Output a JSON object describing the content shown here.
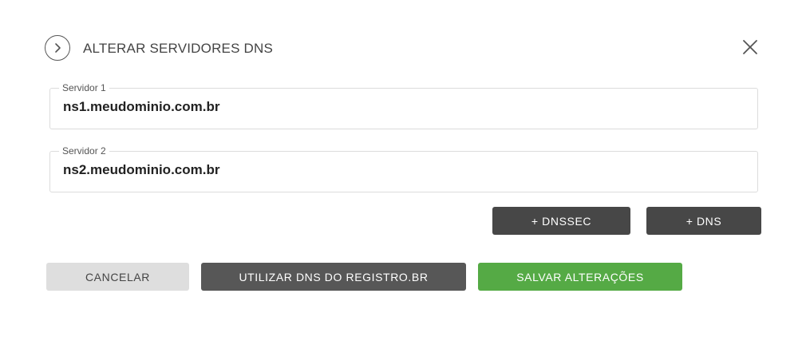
{
  "dialog": {
    "title": "ALTERAR SERVIDORES DNS",
    "header_icon": "chevron-right-icon",
    "close_icon": "close-icon"
  },
  "fields": [
    {
      "label": "Servidor 1",
      "value": "ns1.meudominio.com.br"
    },
    {
      "label": "Servidor 2",
      "value": "ns2.meudominio.com.br"
    }
  ],
  "actions": {
    "add_dnssec": "+ DNSSEC",
    "add_dns": "+ DNS"
  },
  "footer": {
    "cancel": "CANCELAR",
    "use_registro": "UTILIZAR DNS DO REGISTRO.BR",
    "save": "SALVAR ALTERAÇÕES"
  },
  "colors": {
    "save_button": "#55aa45",
    "dark_button": "#474747",
    "cancel_button": "#dedede"
  }
}
